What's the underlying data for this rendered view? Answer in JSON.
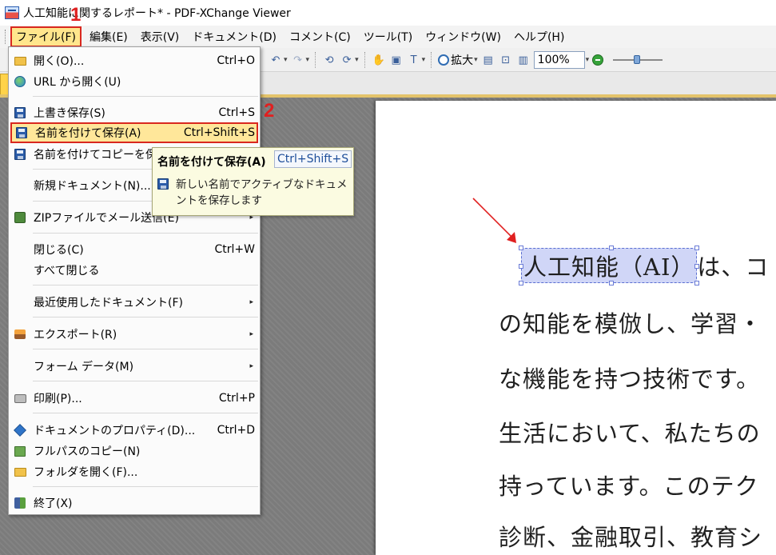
{
  "window": {
    "title": "人工知能に関するレポート* - PDF-XChange Viewer"
  },
  "menubar": {
    "items": [
      "ファイル(F)",
      "編集(E)",
      "表示(V)",
      "ドキュメント(D)",
      "コメント(C)",
      "ツール(T)",
      "ウィンドウ(W)",
      "ヘルプ(H)"
    ]
  },
  "toolbar": {
    "zoom_in_label": "拡大",
    "zoom_value": "100%"
  },
  "file_menu": {
    "open": {
      "label": "開く(O)...",
      "shortcut": "Ctrl+O"
    },
    "open_url": {
      "label": "URL から開く(U)"
    },
    "save": {
      "label": "上書き保存(S)",
      "shortcut": "Ctrl+S"
    },
    "save_as": {
      "label": "名前を付けて保存(A)",
      "shortcut": "Ctrl+Shift+S"
    },
    "save_copy": {
      "label": "名前を付けてコピーを保存"
    },
    "new_doc": {
      "label": "新規ドキュメント(N)..."
    },
    "zip_mail": {
      "label": "ZIPファイルでメール送信(E)"
    },
    "close": {
      "label": "閉じる(C)",
      "shortcut": "Ctrl+W"
    },
    "close_all": {
      "label": "すべて閉じる"
    },
    "recent": {
      "label": "最近使用したドキュメント(F)"
    },
    "export": {
      "label": "エクスポート(R)"
    },
    "form_data": {
      "label": "フォーム データ(M)"
    },
    "print": {
      "label": "印刷(P)...",
      "shortcut": "Ctrl+P"
    },
    "properties": {
      "label": "ドキュメントのプロパティ(D)...",
      "shortcut": "Ctrl+D"
    },
    "copy_path": {
      "label": "フルパスのコピー(N)"
    },
    "open_folder": {
      "label": "フォルダを開く(F)..."
    },
    "exit": {
      "label": "終了(X)"
    }
  },
  "tooltip": {
    "title": "名前を付けて保存(A)",
    "shortcut": "Ctrl+Shift+S",
    "description": "新しい名前でアクティブなドキュメントを保存します"
  },
  "document": {
    "selected_text": "人工知能（AI）",
    "lines": [
      "は、コ",
      "の知能を模倣し、学習・",
      "な機能を持つ技術です。",
      "生活において、私たちの",
      "持っています。このテク",
      "診断、金融取引、教育シ"
    ]
  },
  "callouts": {
    "step1": "1",
    "step2": "2"
  },
  "colors": {
    "highlight_border": "#d9281f",
    "menu_highlight": "#ffe79a",
    "selection": "#d0d6f7",
    "annotation": "#e02020"
  },
  "icons": {
    "open": "folder-icon",
    "open_url": "globe-icon",
    "save": "save-disk-icon",
    "save_as": "save-as-disk-icon",
    "save_copy": "save-copy-disk-icon",
    "zip_mail": "zip-mail-icon",
    "export": "export-icon",
    "print": "printer-icon",
    "properties": "properties-icon",
    "copy_path": "copy-path-icon",
    "open_folder": "open-folder-icon",
    "exit": "exit-icon"
  }
}
